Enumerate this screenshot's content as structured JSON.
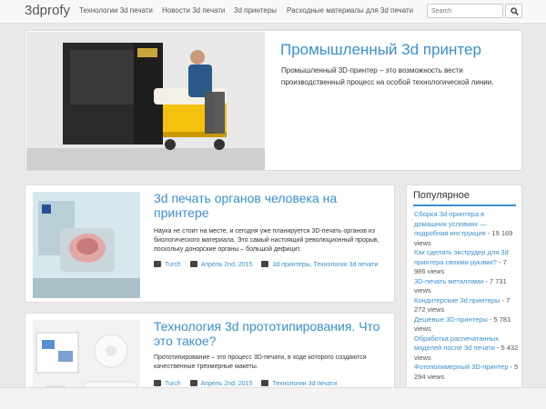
{
  "nav": {
    "brand": "3dprofy",
    "links": [
      "Технологии 3d печати",
      "Новости 3d печати",
      "3d принтеры",
      "Расходные материалы для 3d печати"
    ],
    "search_placeholder": "Search"
  },
  "hero": {
    "title": "Промышленный 3d принтер",
    "text": "Промышленный 3D-принтер – это возможность вести производственный процесс на особой технологической линии."
  },
  "articles": [
    {
      "title": "3d печать органов человека на принтере",
      "text": "Наука не стоит на месте, и сегодня уже планируется 3D-печать органов из биологического материала. Это самый настоящий революционный прорыв, поскольку донорские органы – большой дефицит.",
      "author": "Turch",
      "date": "Апрель 2nd, 2015",
      "categories": "3d принтеры, Технологии 3d печати"
    },
    {
      "title": "Технология 3d прототипирования. Что это такое?",
      "text": "Прототипирование – это процесс 3D-печати, в ходе которого создаются качественные трехмерные макеты.",
      "author": "Turch",
      "date": "Апрель 2nd, 2015",
      "categories": "Технологии 3d печати"
    }
  ],
  "sidebar": {
    "title": "Популярное",
    "items": [
      {
        "link": "Сборка 3d-принтера в домашних условиях — подробная инструкция",
        "views": " - 19 169 views"
      },
      {
        "link": "Как сделать экструдер для 3d принтера своими руками?",
        "views": " - 7 986 views"
      },
      {
        "link": "3D-печать металлами",
        "views": " - 7 731 views"
      },
      {
        "link": "Кондитерские 3d принтеры",
        "views": " - 7 272 views"
      },
      {
        "link": "Дешевые 3D-принтеры",
        "views": " - 5 781 views"
      },
      {
        "link": "Обработка распечатанных моделей после 3d печати",
        "views": " - 5 432 views"
      },
      {
        "link": "Фотополимерный 3D-принтер",
        "views": " - 5 294 views"
      }
    ]
  }
}
